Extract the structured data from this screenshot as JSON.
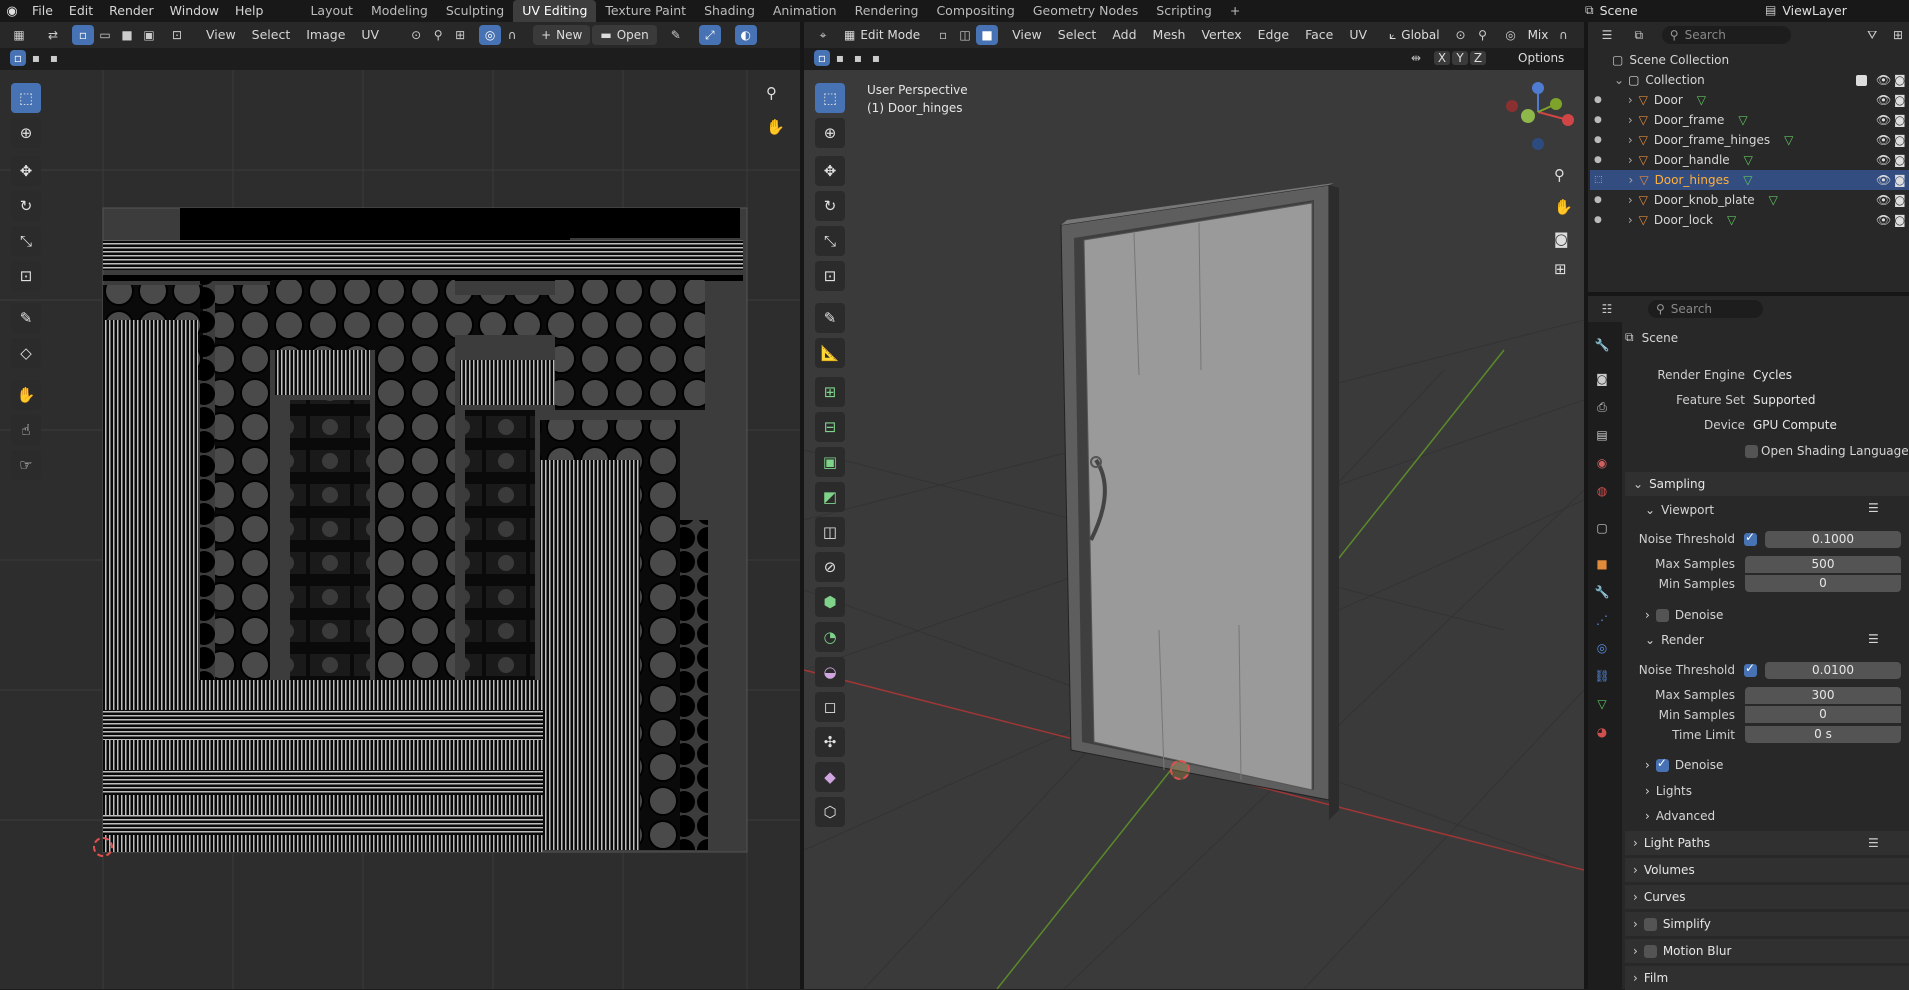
{
  "topbar": {
    "menus": [
      "File",
      "Edit",
      "Render",
      "Window",
      "Help"
    ],
    "workspaces": [
      "Layout",
      "Modeling",
      "Sculpting",
      "UV Editing",
      "Texture Paint",
      "Shading",
      "Animation",
      "Rendering",
      "Compositing",
      "Geometry Nodes",
      "Scripting"
    ],
    "active_workspace": "UV Editing",
    "scene": "Scene",
    "view_layer": "ViewLayer"
  },
  "uv_editor": {
    "menus": [
      "View",
      "Select",
      "Image",
      "UV"
    ],
    "new_label": "New",
    "open_label": "Open"
  },
  "viewport": {
    "mode": "Edit Mode",
    "menus": [
      "View",
      "Select",
      "Add",
      "Mesh",
      "Vertex",
      "Edge",
      "Face",
      "UV"
    ],
    "orientation": "Global",
    "shading_mix": "Mix",
    "options_label": "Options",
    "axes": [
      "X",
      "Y",
      "Z"
    ],
    "overlay_title": "User Perspective",
    "overlay_object": "(1) Door_hinges"
  },
  "outliner": {
    "search_placeholder": "Search",
    "root": "Scene Collection",
    "collection": "Collection",
    "objects": [
      "Door",
      "Door_frame",
      "Door_frame_hinges",
      "Door_handle",
      "Door_hinges",
      "Door_knob_plate",
      "Door_lock"
    ],
    "selected": "Door_hinges"
  },
  "properties": {
    "search_placeholder": "Search",
    "context": "Scene",
    "render_engine_label": "Render Engine",
    "render_engine": "Cycles",
    "feature_set_label": "Feature Set",
    "feature_set": "Supported",
    "device_label": "Device",
    "device": "GPU Compute",
    "osl_label": "Open Shading Language",
    "sampling": "Sampling",
    "viewport": "Viewport",
    "vp_noise_label": "Noise Threshold",
    "vp_noise": "0.1000",
    "vp_max_label": "Max Samples",
    "vp_max": "500",
    "vp_min_label": "Min Samples",
    "vp_min": "0",
    "vp_denoise": "Denoise",
    "render": "Render",
    "r_noise_label": "Noise Threshold",
    "r_noise": "0.0100",
    "r_max_label": "Max Samples",
    "r_max": "300",
    "r_min_label": "Min Samples",
    "r_min": "0",
    "r_time_label": "Time Limit",
    "r_time": "0 s",
    "r_denoise": "Denoise",
    "lights": "Lights",
    "advanced": "Advanced",
    "light_paths": "Light Paths",
    "volumes": "Volumes",
    "curves": "Curves",
    "simplify": "Simplify",
    "motion_blur": "Motion Blur",
    "film": "Film"
  },
  "colors": {
    "accent": "#4772b3",
    "bg": "#1d1d1d",
    "header": "#282828"
  }
}
